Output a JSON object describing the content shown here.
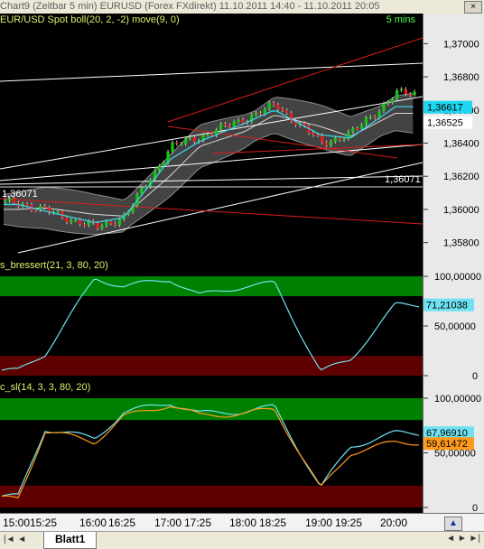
{
  "window": {
    "title": "Chart9 (Zeitbar 5 min)  EURUSD (Forex FXdirekt) 11.10.2011 14:40 - 11.10.2011 20:05",
    "close_label": "×"
  },
  "main_panel": {
    "header": "EUR/USD Spot boll(20, 2, -2) move(9, 0)",
    "header_right": "5 mins",
    "left_price_label": "1,36071",
    "right_price_label": "1,36071",
    "axis_ticks": [
      "1,37000",
      "1,36800",
      "1,36600",
      "1,36400",
      "1,36200",
      "1,36000",
      "1,35800"
    ],
    "last_price_badge": "1,36617",
    "other_price_badge": "1,36525",
    "colors": {
      "candle_up": "#16c216",
      "candle_down": "#e61d1d",
      "band_fill": "#5a5a5a",
      "middle_band": "#d9d9d9",
      "mov_avg": "#39d3e6",
      "trendline_white": "#ffffff",
      "trendline_red": "#d91d1d"
    }
  },
  "panel_2": {
    "header": "s_bressert(21, 3, 80, 20)",
    "axis_ticks": [
      "100,00000",
      "50,00000",
      "0"
    ],
    "badge": "71,21038",
    "colors": {
      "line": "#6fe2f2",
      "overbought_zone": "#008000",
      "oversold_zone": "#5e0000"
    }
  },
  "panel_3": {
    "header": "c_sl(14, 3, 3, 80, 20)",
    "axis_ticks": [
      "100,00000",
      "50,00000",
      "0"
    ],
    "badge_1": "67,96910",
    "badge_2": "59,61472",
    "colors": {
      "line_1": "#6fe2f2",
      "line_2": "#ff9a1b",
      "overbought_zone": "#008000",
      "oversold_zone": "#5e0000"
    }
  },
  "x_axis": {
    "ticks": [
      "15:00",
      "15:25",
      "16:00",
      "16:25",
      "17:00",
      "17:25",
      "18:00",
      "18:25",
      "19:00",
      "19:25",
      "20:00"
    ]
  },
  "bottom_bar": {
    "sheet_tab": "Blatt1",
    "left_nav": "|◄ ◄",
    "right_nav": "◄ ► ►|"
  },
  "chart_data": [
    {
      "type": "line",
      "title": "EUR/USD Spot boll(20, 2, -2) move(9, 0)",
      "xlabel": "",
      "ylabel": "",
      "ylim": [
        1.357,
        1.371
      ],
      "x": [
        "15:00",
        "15:25",
        "16:00",
        "16:25",
        "17:00",
        "17:25",
        "18:00",
        "18:25",
        "19:00",
        "19:25",
        "20:00"
      ],
      "series": [
        {
          "name": "EUR/USD Spot",
          "values": [
            1.3604,
            1.3599,
            1.3589,
            1.3596,
            1.3638,
            1.3644,
            1.3655,
            1.3663,
            1.364,
            1.3646,
            1.367
          ]
        },
        {
          "name": "boll(20, 2, -2)",
          "values": [
            1.36,
            1.3601,
            1.3597,
            1.3596,
            1.362,
            1.3638,
            1.3647,
            1.3657,
            1.365,
            1.3644,
            1.3658
          ]
        },
        {
          "name": "move(9, 0)",
          "values": [
            1.3603,
            1.3599,
            1.3592,
            1.3595,
            1.363,
            1.3641,
            1.3652,
            1.366,
            1.3645,
            1.3643,
            1.3662
          ]
        }
      ],
      "annotations": [
        "1,36071",
        "1,36617",
        "1,36525"
      ],
      "grid": true
    },
    {
      "type": "line",
      "title": "s_bressert(21, 3, 80, 20)",
      "ylim": [
        0,
        100
      ],
      "x": [
        "15:00",
        "15:25",
        "16:00",
        "16:25",
        "17:00",
        "17:25",
        "18:00",
        "18:25",
        "19:00",
        "19:25",
        "20:00"
      ],
      "series": [
        {
          "name": "s_bressert(21, 3, 80, 20)",
          "values": [
            5,
            22,
            98,
            90,
            97,
            81,
            90,
            93,
            4,
            16,
            71.21
          ]
        }
      ],
      "grid": false
    },
    {
      "type": "line",
      "title": "c_sl(14, 3, 3, 80, 20)",
      "ylim": [
        0,
        100
      ],
      "x": [
        "15:00",
        "15:25",
        "16:00",
        "16:25",
        "17:00",
        "17:25",
        "18:00",
        "18:25",
        "19:00",
        "19:25",
        "20:00"
      ],
      "series": [
        {
          "values": [
            10,
            72,
            63,
            87,
            96,
            86,
            88,
            92,
            18,
            56,
            67.97
          ]
        },
        {
          "values": [
            8,
            70,
            60,
            83,
            94,
            84,
            86,
            90,
            17,
            50,
            59.61
          ]
        }
      ],
      "grid": false
    }
  ]
}
